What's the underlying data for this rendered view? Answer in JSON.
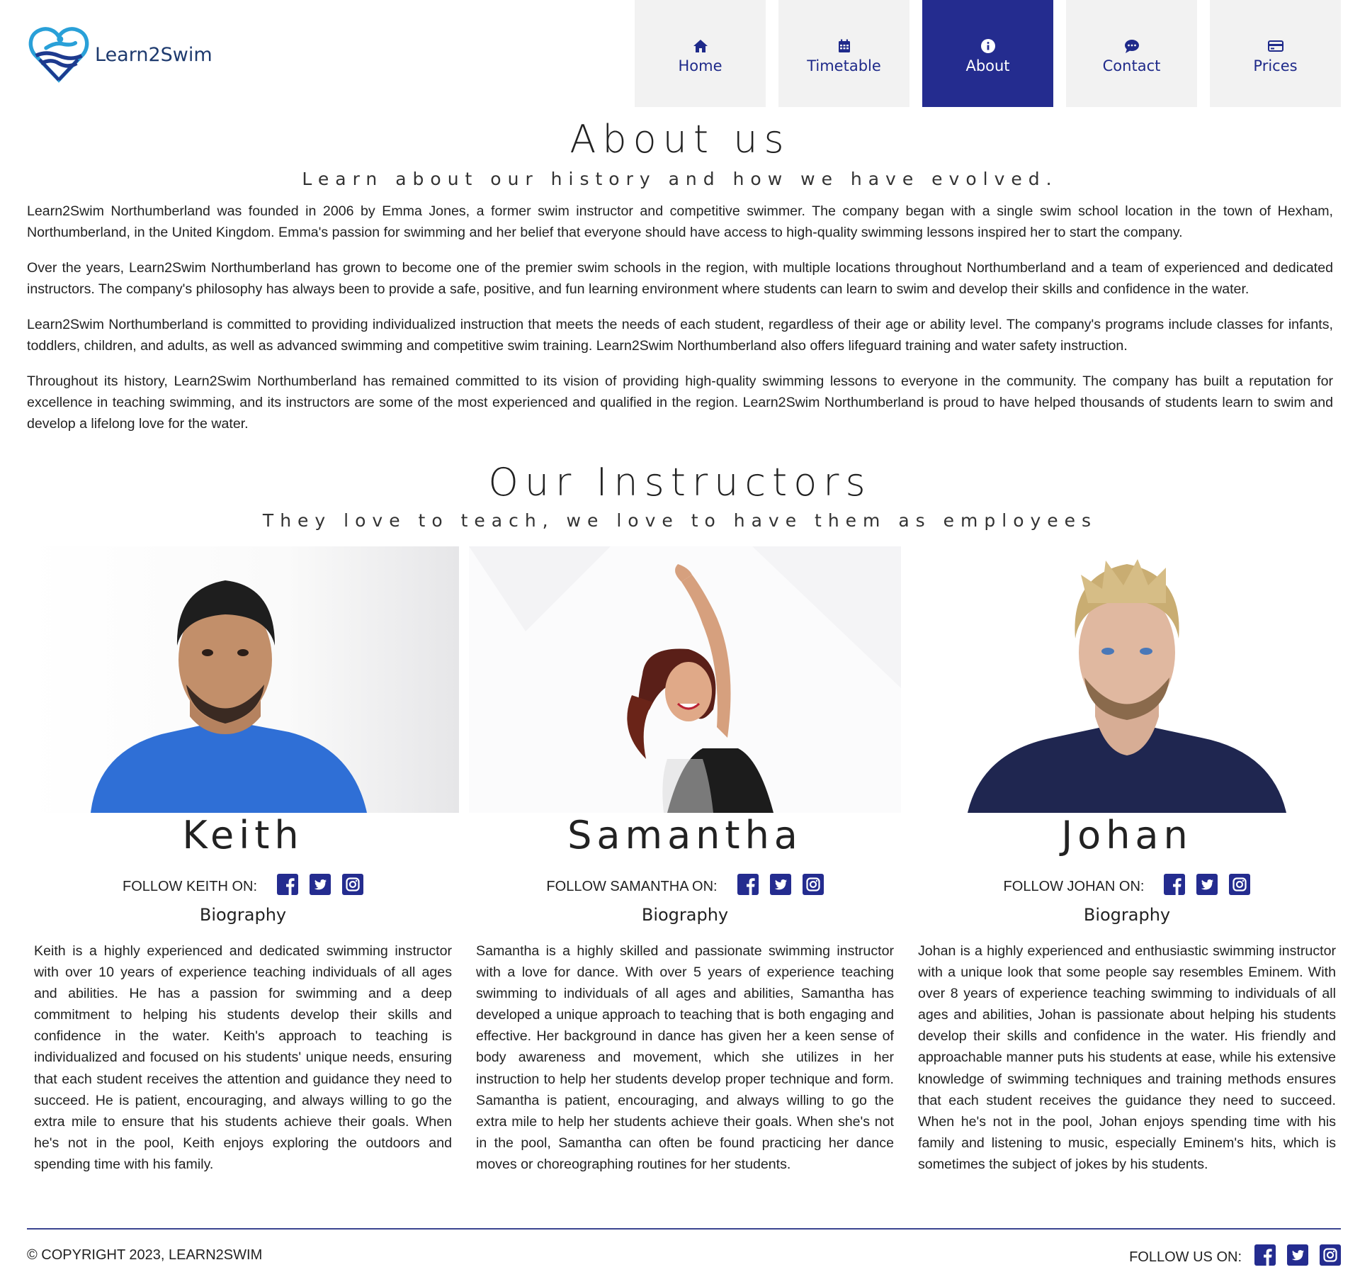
{
  "brand": {
    "name": "Learn2Swim",
    "accent": "#242c8f",
    "nav_bg": "#f2f2f2"
  },
  "nav": [
    {
      "label": "Home",
      "icon": "home-icon",
      "active": false
    },
    {
      "label": "Timetable",
      "icon": "calendar-icon",
      "active": false
    },
    {
      "label": "About",
      "icon": "info-icon",
      "active": true
    },
    {
      "label": "Contact",
      "icon": "chat-icon",
      "active": false
    },
    {
      "label": "Prices",
      "icon": "credit-card-icon",
      "active": false
    }
  ],
  "about": {
    "title": "About us",
    "subtitle": "Learn about our history and how we have evolved.",
    "paragraphs": [
      "Learn2Swim Northumberland was founded in 2006 by Emma Jones, a former swim instructor and competitive swimmer. The company began with a single swim school location in the town of Hexham, Northumberland, in the United Kingdom. Emma's passion for swimming and her belief that everyone should have access to high-quality swimming lessons inspired her to start the company.",
      "Over the years, Learn2Swim Northumberland has grown to become one of the premier swim schools in the region, with multiple locations throughout Northumberland and a team of experienced and dedicated instructors. The company's philosophy has always been to provide a safe, positive, and fun learning environment where students can learn to swim and develop their skills and confidence in the water.",
      "Learn2Swim Northumberland is committed to providing individualized instruction that meets the needs of each student, regardless of their age or ability level. The company's programs include classes for infants, toddlers, children, and adults, as well as advanced swimming and competitive swim training. Learn2Swim Northumberland also offers lifeguard training and water safety instruction.",
      "Throughout its history, Learn2Swim Northumberland has remained committed to its vision of providing high-quality swimming lessons to everyone in the community. The company has built a reputation for excellence in teaching swimming, and its instructors are some of the most experienced and qualified in the region. Learn2Swim Northumberland is proud to have helped thousands of students learn to swim and develop a lifelong love for the water."
    ]
  },
  "instructors_section": {
    "title": "Our Instructors",
    "subtitle": "They love to teach, we love to have them as employees"
  },
  "instructors": [
    {
      "name": "Keith",
      "follow_label": "FOLLOW KEITH ON:",
      "bio_heading": "Biography",
      "bio": "Keith is a highly experienced and dedicated swimming instructor with over 10 years of experience teaching individuals of all ages and abilities. He has a passion for swimming and a deep commitment to helping his students develop their skills and confidence in the water. Keith's approach to teaching is individualized and focused on his students' unique needs, ensuring that each student receives the attention and guidance they need to succeed. He is patient, encouraging, and always willing to go the extra mile to ensure that his students achieve their goals. When he's not in the pool, Keith enjoys exploring the outdoors and spending time with his family."
    },
    {
      "name": "Samantha",
      "follow_label": "FOLLOW SAMANTHA ON:",
      "bio_heading": "Biography",
      "bio": "Samantha is a highly skilled and passionate swimming instructor with a love for dance. With over 5 years of experience teaching swimming to individuals of all ages and abilities, Samantha has developed a unique approach to teaching that is both engaging and effective. Her background in dance has given her a keen sense of body awareness and movement, which she utilizes in her instruction to help her students develop proper technique and form. Samantha is patient, encouraging, and always willing to go the extra mile to help her students achieve their goals. When she's not in the pool, Samantha can often be found practicing her dance moves or choreographing routines for her students."
    },
    {
      "name": "Johan",
      "follow_label": "FOLLOW JOHAN ON:",
      "bio_heading": "Biography",
      "bio": "Johan is a highly experienced and enthusiastic swimming instructor with a unique look that some people say resembles Eminem. With over 8 years of experience teaching swimming to individuals of all ages and abilities, Johan is passionate about helping his students develop their skills and confidence in the water. His friendly and approachable manner puts his students at ease, while his extensive knowledge of swimming techniques and training methods ensures that each student receives the guidance they need to succeed. When he's not in the pool, Johan enjoys spending time with his family and listening to music, especially Eminem's hits, which is sometimes the subject of jokes by his students."
    }
  ],
  "social_icons": [
    "facebook-icon",
    "twitter-icon",
    "instagram-icon"
  ],
  "footer": {
    "copyright": "© COPYRIGHT 2023, LEARN2SWIM",
    "follow_label": "FOLLOW US ON:"
  }
}
